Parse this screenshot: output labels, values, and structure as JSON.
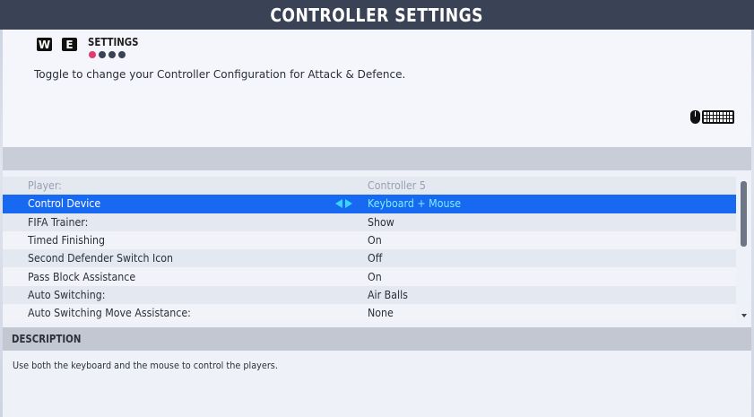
{
  "title": "CONTROLLER SETTINGS",
  "header": {
    "key_w": "W",
    "key_e": "E",
    "section_label": "SETTINGS",
    "page_dots": {
      "total": 4,
      "active_index": 0
    },
    "instruction": "Toggle to change your Controller Configuration for Attack & Defence.",
    "device_icons": [
      "mouse-icon",
      "keyboard-icon"
    ]
  },
  "settings": [
    {
      "label": "Player:",
      "value": "Controller 5",
      "state": "disabled"
    },
    {
      "label": "Control Device",
      "value": "Keyboard + Mouse",
      "state": "selected"
    },
    {
      "label": "FIFA Trainer:",
      "value": "Show",
      "state": "normal"
    },
    {
      "label": "Timed Finishing",
      "value": "On",
      "state": "normal"
    },
    {
      "label": "Second Defender Switch Icon",
      "value": "Off",
      "state": "normal"
    },
    {
      "label": "Pass Block Assistance",
      "value": "On",
      "state": "normal"
    },
    {
      "label": "Auto Switching:",
      "value": "Air Balls",
      "state": "normal"
    },
    {
      "label": "Auto Switching Move Assistance:",
      "value": "None",
      "state": "normal"
    }
  ],
  "description": {
    "heading": "DESCRIPTION",
    "text": "Use both the keyboard and the mouse to control the players."
  },
  "colors": {
    "title_bar": "#3a4256",
    "selected_row": "#1769f2",
    "selected_value": "#7df0ff",
    "active_dot": "#e23a72"
  }
}
